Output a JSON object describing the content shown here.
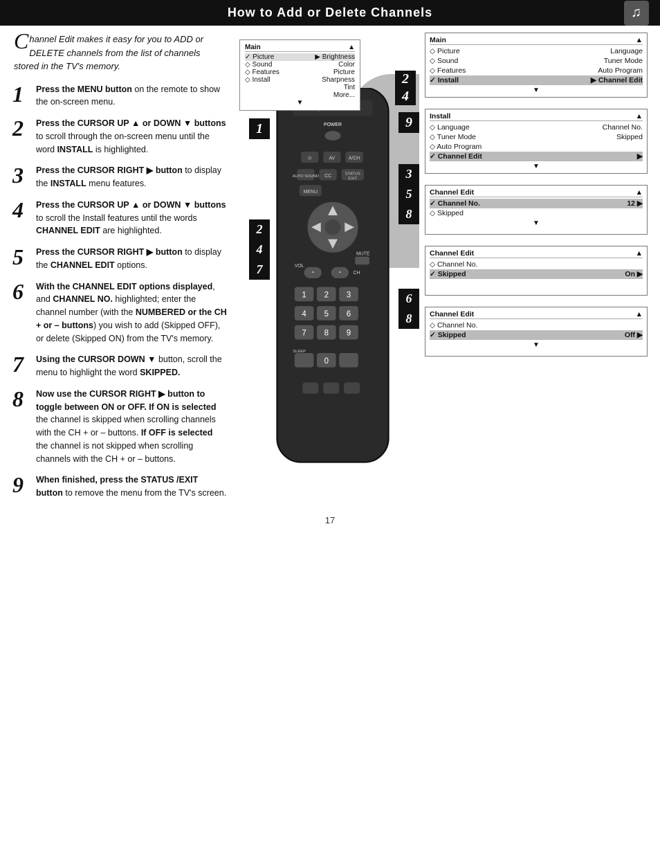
{
  "header": {
    "title": "How to Add or Delete Channels",
    "icon": "♪"
  },
  "intro": {
    "text": "hannel Edit makes it easy for you to ADD or DELETE channels from the list of channels stored in the TV's memory."
  },
  "steps": [
    {
      "number": "1",
      "html": "<strong>Press the MENU button</strong> on the remote to show the on-screen menu."
    },
    {
      "number": "2",
      "html": "<strong>Press the CURSOR UP ▲ or DOWN ▼ buttons</strong> to scroll through the on-screen menu until the word <strong>INSTALL</strong> is highlighted."
    },
    {
      "number": "3",
      "html": "<strong>Press the CURSOR RIGHT ▶ button</strong> to display the <strong>INSTALL</strong> menu features."
    },
    {
      "number": "4",
      "html": "<strong>Press the CURSOR UP ▲ or DOWN ▼ buttons</strong> to scroll the Install features until the words <strong>CHANNEL EDIT</strong> are highlighted."
    },
    {
      "number": "5",
      "html": "<strong>Press the CURSOR RIGHT ▶ button</strong> to display the <strong>CHANNEL EDIT</strong> options."
    },
    {
      "number": "6",
      "html": "<strong>With the CHANNEL EDIT options displayed</strong>, and <strong>CHANNEL NO.</strong> highlighted; enter the channel number (with the <strong>NUMBERED or the CH + or – buttons</strong>) you wish to add (Skipped OFF), or delete (Skipped ON) from the TV's memory."
    },
    {
      "number": "7",
      "html": "<strong>Using the CURSOR DOWN ▼</strong> button, scroll the menu to highlight the word <strong>SKIPPED.</strong>"
    },
    {
      "number": "8",
      "html": "<strong>Now use the CURSOR RIGHT ▶ button to toggle between ON or OFF. If ON is selected</strong> the channel is skipped when scrolling channels with the CH + or – buttons. <strong>If OFF is selected</strong> the channel is not skipped when scrolling channels with the CH + or – buttons."
    },
    {
      "number": "9",
      "html": "<strong>When finished, press the STATUS/EXIT button</strong> to remove the menu from the TV's screen."
    }
  ],
  "menus": [
    {
      "id": "menu1",
      "title": "Main",
      "title_arrow": "▲",
      "rows": [
        {
          "label": "✓ Picture",
          "value": "▶ Brightness",
          "highlight": false
        },
        {
          "label": "◇ Sound",
          "value": "Color",
          "highlight": false
        },
        {
          "label": "◇ Features",
          "value": "Picture",
          "highlight": false
        },
        {
          "label": "◇ Install",
          "value": "Sharpness",
          "highlight": false
        },
        {
          "label": "",
          "value": "Tint",
          "highlight": false
        },
        {
          "label": "",
          "value": "More...",
          "highlight": false
        }
      ],
      "footer": "▼"
    },
    {
      "id": "menu2",
      "title": "Main",
      "title_arrow": "▲",
      "rows": [
        {
          "label": "◇ Picture",
          "value": "Language",
          "highlight": false
        },
        {
          "label": "◇ Sound",
          "value": "Tuner Mode",
          "highlight": false
        },
        {
          "label": "◇ Features",
          "value": "Auto Program",
          "highlight": false
        },
        {
          "label": "✓ Install",
          "value": "▶ Channel Edit",
          "highlight": true
        }
      ],
      "footer": "▼"
    },
    {
      "id": "menu3",
      "title": "Install",
      "title_arrow": "▲",
      "rows": [
        {
          "label": "◇ Language",
          "value": "Channel No.",
          "highlight": false
        },
        {
          "label": "◇ Tuner Mode",
          "value": "Skipped",
          "highlight": false
        },
        {
          "label": "◇ Auto Program",
          "value": "",
          "highlight": false
        },
        {
          "label": "✓ Channel Edit",
          "value": "▶",
          "highlight": true
        }
      ],
      "footer": "▼"
    },
    {
      "id": "menu4",
      "title": "Channel Edit",
      "title_arrow": "▲",
      "rows": [
        {
          "label": "✓ Channel No.",
          "value": "12 ▶",
          "highlight": true
        },
        {
          "label": "◇ Skipped",
          "value": "",
          "highlight": false
        }
      ],
      "footer": "▼"
    },
    {
      "id": "menu5",
      "title": "Channel Edit",
      "title_arrow": "▲",
      "rows": [
        {
          "label": "◇ Channel No.",
          "value": "",
          "highlight": false
        },
        {
          "label": "✓ Skipped",
          "value": "On ▶",
          "highlight": true
        }
      ],
      "footer": ""
    },
    {
      "id": "menu6",
      "title": "Channel Edit",
      "title_arrow": "▲",
      "rows": [
        {
          "label": "◇ Channel No.",
          "value": "",
          "highlight": false
        },
        {
          "label": "✓ Skipped",
          "value": "Off ▶",
          "highlight": true
        }
      ],
      "footer": "▼"
    }
  ],
  "page_number": "17"
}
